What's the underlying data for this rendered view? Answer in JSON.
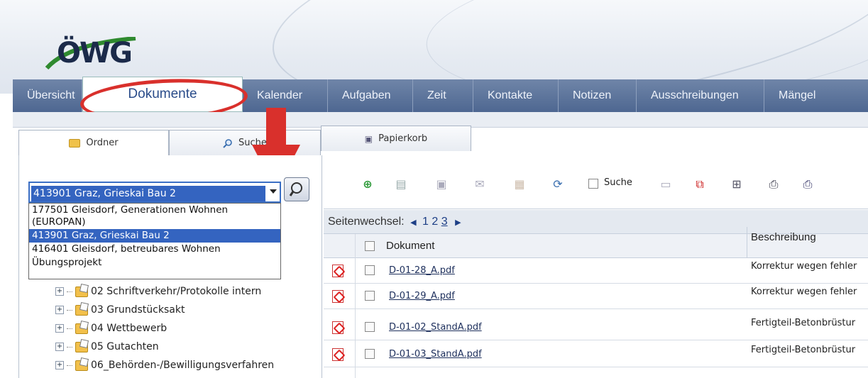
{
  "logo": {
    "text": "ÖWG"
  },
  "nav": {
    "items": [
      "Übersicht",
      "Dokumente",
      "Kalender",
      "Aufgaben",
      "Zeit",
      "Kontakte",
      "Notizen",
      "Ausschreibungen",
      "Mängel"
    ],
    "active": "Dokumente"
  },
  "left_tabs": {
    "ordner": "Ordner",
    "suche": "Suche",
    "papierkorb": "Papierkorb"
  },
  "project_select": {
    "selected": "413901 Graz, Grieskai Bau 2",
    "options": [
      "177501 Gleisdorf, Generationen Wohnen (EUROPAN)",
      "413901 Graz, Grieskai Bau 2",
      "416401 Gleisdorf, betreubares Wohnen",
      "Übungsprojekt"
    ]
  },
  "tree": {
    "items": [
      "02 Schriftverkehr/Protokolle intern",
      "03 Grundstücksakt",
      "04 Wettbewerb",
      "05 Gutachten",
      "06_Behörden-/Bewilligungsverfahren"
    ]
  },
  "toolbar": {
    "suche_label": "Suche"
  },
  "paging": {
    "label": "Seitenwechsel:",
    "pages": [
      "1",
      "2",
      "3"
    ],
    "current": "3"
  },
  "table": {
    "col_document": "Dokument",
    "col_description": "Beschreibung",
    "rows": [
      {
        "name": "D-01-28_A.pdf",
        "desc": "Korrektur wegen fehler"
      },
      {
        "name": "D-01-29_A.pdf",
        "desc": "Korrektur wegen fehler"
      },
      {
        "name": "D-01-02_StandA.pdf",
        "desc": "Fertigteil-Betonbrüstur"
      },
      {
        "name": "D-01-03_StandA.pdf",
        "desc": "Fertigteil-Betonbrüstur"
      }
    ]
  },
  "colors": {
    "nav_bg": "#5a7199",
    "accent_red": "#d9302c",
    "selection": "#3464c0"
  }
}
